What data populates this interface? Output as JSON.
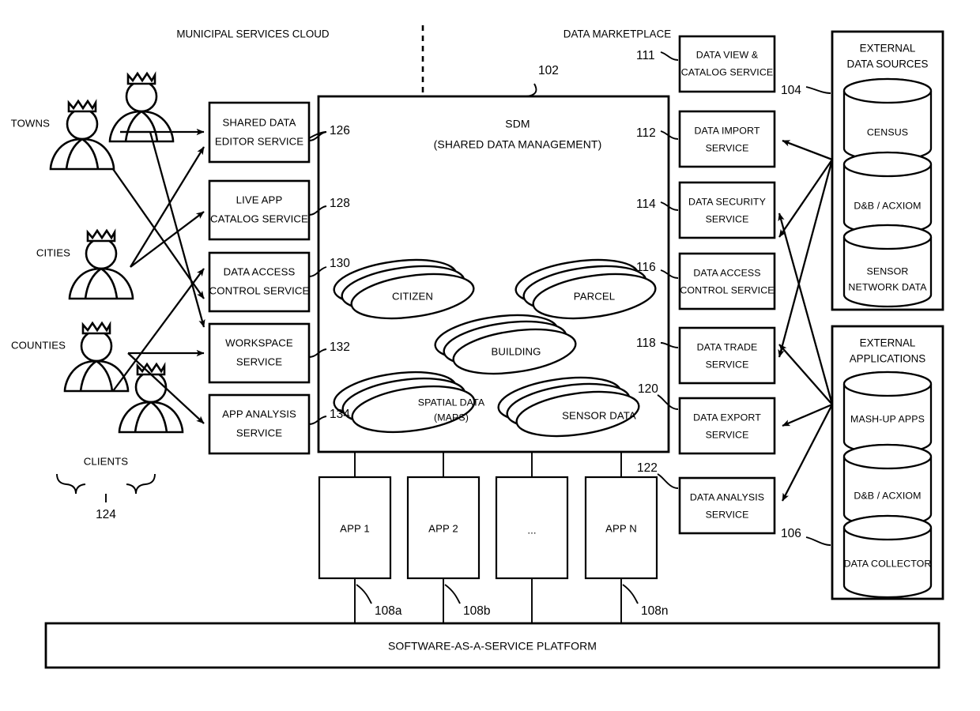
{
  "figure": {
    "type": "patent-block-diagram",
    "section_headers": {
      "municipal_services_cloud": "MUNICIPAL SERVICES CLOUD",
      "data_marketplace": "DATA MARKETPLACE"
    },
    "sdm": {
      "title": "SDM",
      "subtitle": "(SHARED DATA MANAGEMENT)",
      "ref": "102",
      "entities": [
        {
          "label": "CITIZEN",
          "label2": ""
        },
        {
          "label": "PARCEL",
          "label2": ""
        },
        {
          "label": "BUILDING",
          "label2": ""
        },
        {
          "label": "SPATIAL DATA",
          "label2": "(MAPS)"
        },
        {
          "label": "SENSOR DATA",
          "label2": ""
        }
      ]
    },
    "clients": {
      "group_label": "CLIENTS",
      "group_ref": "124",
      "tiers": [
        "TOWNS",
        "CITIES",
        "COUNTIES"
      ]
    },
    "left_services": [
      {
        "line1": "SHARED DATA",
        "line2": "EDITOR SERVICE",
        "ref": "126"
      },
      {
        "line1": "LIVE APP",
        "line2": "CATALOG SERVICE",
        "ref": "128"
      },
      {
        "line1": "DATA ACCESS",
        "line2": "CONTROL SERVICE",
        "ref": "130"
      },
      {
        "line1": "WORKSPACE",
        "line2": "SERVICE",
        "ref": "132"
      },
      {
        "line1": "APP ANALYSIS",
        "line2": "SERVICE",
        "ref": "134"
      }
    ],
    "right_services": [
      {
        "line1": "DATA VIEW &",
        "line2": "CATALOG SERVICE",
        "ref": "111"
      },
      {
        "line1": "DATA IMPORT",
        "line2": "SERVICE",
        "ref": "112"
      },
      {
        "line1": "DATA SECURITY",
        "line2": "SERVICE",
        "ref": "114"
      },
      {
        "line1": "DATA ACCESS",
        "line2": "CONTROL SERVICE",
        "ref": "116"
      },
      {
        "line1": "DATA TRADE",
        "line2": "SERVICE",
        "ref": "118"
      },
      {
        "line1": "DATA EXPORT",
        "line2": "SERVICE",
        "ref": "120"
      },
      {
        "line1": "DATA ANALYSIS",
        "line2": "SERVICE",
        "ref": "122"
      }
    ],
    "external_data_sources": {
      "title_line1": "EXTERNAL",
      "title_line2": "DATA SOURCES",
      "ref": "104",
      "items": [
        {
          "line1": "CENSUS",
          "line2": ""
        },
        {
          "line1": "D&B / ACXIOM",
          "line2": ""
        },
        {
          "line1": "SENSOR",
          "line2": "NETWORK DATA"
        }
      ]
    },
    "external_applications": {
      "title_line1": "EXTERNAL",
      "title_line2": "APPLICATIONS",
      "ref": "106",
      "items": [
        {
          "line1": "MASH-UP APPS",
          "line2": ""
        },
        {
          "line1": "D&B / ACXIOM",
          "line2": ""
        },
        {
          "line1": "DATA COLLECTOR",
          "line2": ""
        }
      ]
    },
    "apps": [
      {
        "label": "APP 1",
        "ref": "108a"
      },
      {
        "label": "APP 2",
        "ref": "108b"
      },
      {
        "label": "...",
        "ref": ""
      },
      {
        "label": "APP N",
        "ref": "108n"
      }
    ],
    "platform": {
      "label": "SOFTWARE-AS-A-SERVICE PLATFORM"
    },
    "colors": {
      "stroke": "#000000",
      "fill": "#ffffff"
    }
  }
}
